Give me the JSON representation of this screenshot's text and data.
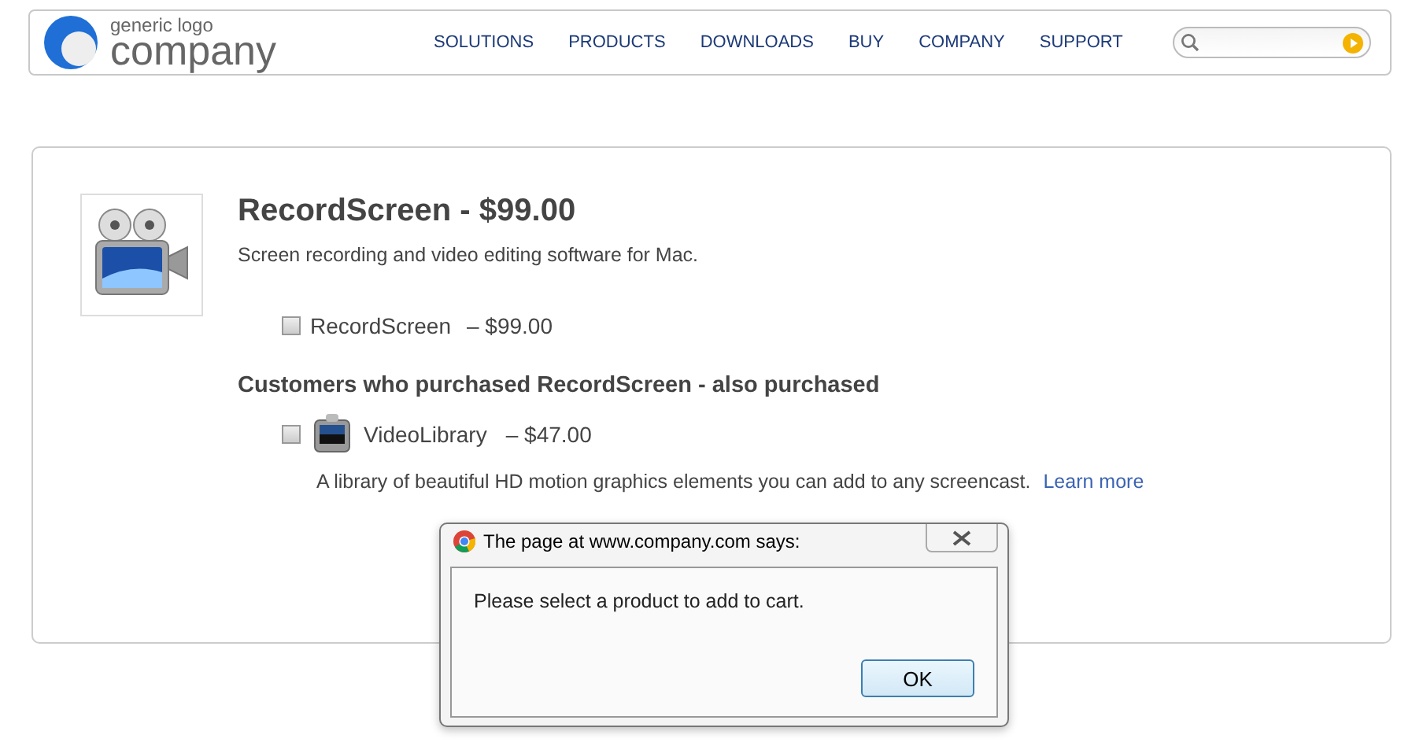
{
  "header": {
    "logo": {
      "small": "generic logo",
      "large": "company"
    },
    "nav": [
      {
        "label": "SOLUTIONS"
      },
      {
        "label": "PRODUCTS"
      },
      {
        "label": "DOWNLOADS"
      },
      {
        "label": "BUY"
      },
      {
        "label": "COMPANY"
      },
      {
        "label": "SUPPORT"
      }
    ]
  },
  "product": {
    "title": "RecordScreen - $99.00",
    "description": "Screen recording and video editing software for Mac.",
    "option": {
      "name": "RecordScreen",
      "price": "– $99.00",
      "checked": false
    }
  },
  "upsell": {
    "heading": "Customers who purchased RecordScreen - also purchased",
    "items": [
      {
        "name": "VideoLibrary",
        "price": "– $47.00",
        "checked": false,
        "description": "A library of beautiful HD motion graphics elements you can add to any screencast.",
        "link": "Learn more"
      }
    ]
  },
  "dialog": {
    "title": "The page at www.company.com says:",
    "message": "Please select a product to add to cart.",
    "button": "OK"
  }
}
